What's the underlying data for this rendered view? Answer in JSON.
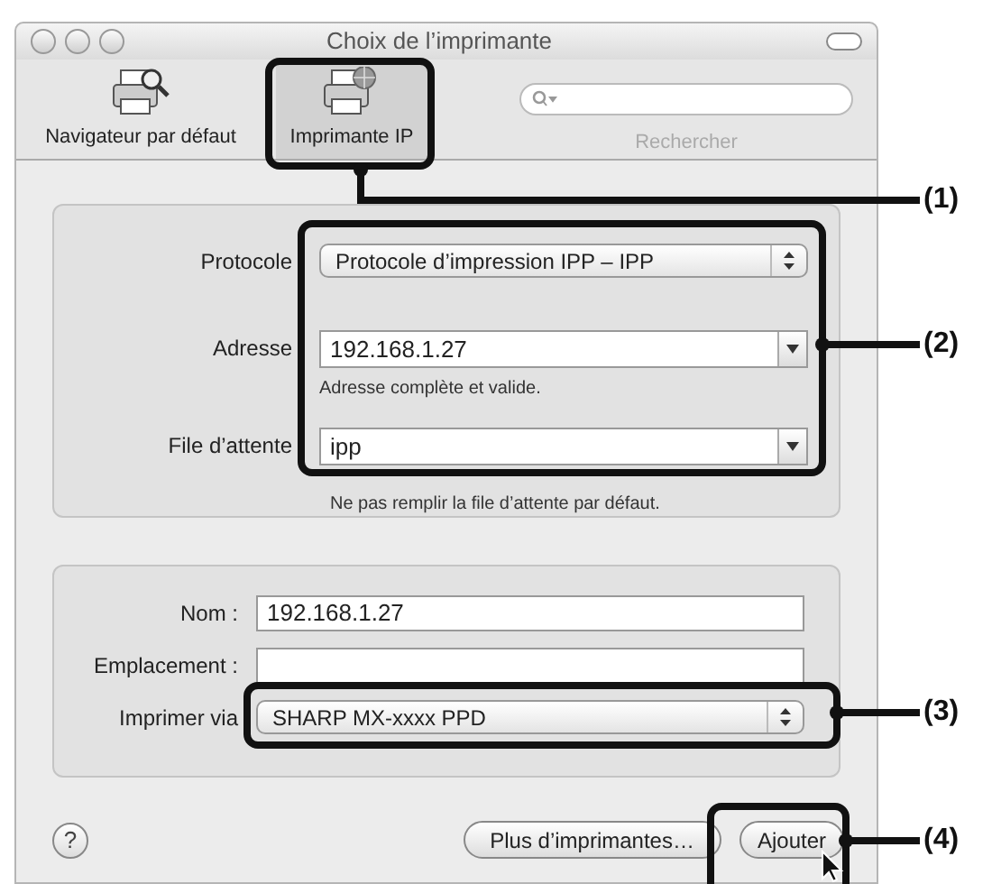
{
  "window": {
    "title": "Choix de l’imprimante"
  },
  "toolbar": {
    "items": [
      {
        "kind": "browser",
        "label": "Navigateur par défaut",
        "selected": false
      },
      {
        "kind": "ip",
        "label": "Imprimante IP",
        "selected": true
      }
    ],
    "search": {
      "label": "Rechercher"
    }
  },
  "connection": {
    "fields": [
      {
        "kind": "popup",
        "label": "Protocole",
        "value": "Protocole d’impression IPP – IPP"
      },
      {
        "kind": "combo",
        "label": "Adresse",
        "value": "192.168.1.27",
        "hint": "Adresse complète et valide."
      },
      {
        "kind": "combo",
        "label": "File d’attente",
        "value": "ipp",
        "hint": "Ne pas remplir la file d’attente par défaut."
      }
    ]
  },
  "printer": {
    "fields": [
      {
        "kind": "text",
        "label": "Nom :",
        "value": "192.168.1.27"
      },
      {
        "kind": "text",
        "label": "Emplacement :"
      },
      {
        "kind": "popup",
        "label": "Imprimer via",
        "value": "SHARP MX-xxxx PPD"
      }
    ]
  },
  "buttons": {
    "help": "?",
    "more": "Plus d’imprimantes…",
    "add": "Ajouter"
  },
  "callouts": [
    "(1)",
    "(2)",
    "(3)",
    "(4)"
  ]
}
